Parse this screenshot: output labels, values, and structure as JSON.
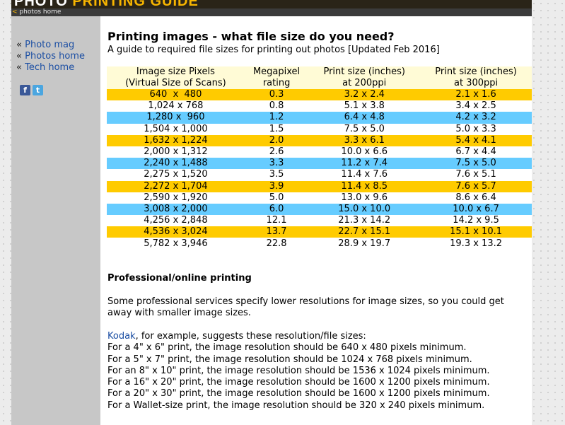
{
  "header": {
    "logo_word1": "PHOTO",
    "logo_word2": "PRINTING GUIDE",
    "breadcrumb_arrow": "<",
    "breadcrumb": "photos home"
  },
  "sidebar": {
    "items": [
      {
        "prefix": "«",
        "label": "Photo mag"
      },
      {
        "prefix": "«",
        "label": "Photos home"
      },
      {
        "prefix": "«",
        "label": "Tech home"
      }
    ],
    "social": {
      "facebook": "f",
      "twitter": "t"
    }
  },
  "main": {
    "title": "Printing images - what file size do you need?",
    "subtitle": "A guide to required file sizes for printing out photos [Updated Feb 2016]",
    "table": {
      "headers": [
        {
          "line1": "Image size Pixels",
          "line2": "(Virtual Size of Scans)"
        },
        {
          "line1": "Megapixel",
          "line2": "rating"
        },
        {
          "line1": "Print size (inches)",
          "line2": "at 200ppi"
        },
        {
          "line1": "Print size (inches)",
          "line2": "at 300ppi"
        }
      ],
      "rows": [
        {
          "color": "orange",
          "cells": [
            "640  x  480",
            "0.3",
            "3.2 x 2.4",
            "2.1 x 1.6"
          ]
        },
        {
          "color": "white",
          "cells": [
            "1,024 x 768",
            "0.8",
            "5.1 x 3.8",
            "3.4 x 2.5"
          ]
        },
        {
          "color": "blue",
          "cells": [
            "1,280 x  960",
            "1.2",
            "6.4 x 4.8",
            "4.2 x 3.2"
          ]
        },
        {
          "color": "white",
          "cells": [
            "1,504 x 1,000",
            "1.5",
            "7.5 x 5.0",
            "5.0 x 3.3"
          ]
        },
        {
          "color": "orange",
          "cells": [
            "1,632 x 1,224",
            "2.0",
            "3.3 x 6.1",
            "5.4 x 4.1"
          ]
        },
        {
          "color": "white",
          "cells": [
            "2,000 x 1,312",
            "2.6",
            "10.0 x 6.6",
            "6.7 x 4.4"
          ]
        },
        {
          "color": "blue",
          "cells": [
            "2,240 x 1,488",
            "3.3",
            "11.2 x 7.4",
            "7.5 x 5.0"
          ]
        },
        {
          "color": "white",
          "cells": [
            "2,275 x 1,520",
            "3.5",
            "11.4 x 7.6",
            "7.6 x 5.1"
          ]
        },
        {
          "color": "orange",
          "cells": [
            "2,272 x 1,704",
            "3.9",
            "11.4 x 8.5",
            "7.6 x 5.7"
          ]
        },
        {
          "color": "white",
          "cells": [
            "2,590 x 1,920",
            "5.0",
            "13.0 x 9.6",
            "8.6 x 6.4"
          ]
        },
        {
          "color": "blue",
          "cells": [
            "3,008 x 2,000",
            "6.0",
            "15.0 x 10.0",
            "10.0 x 6.7"
          ]
        },
        {
          "color": "white",
          "cells": [
            "4,256 x 2,848",
            "12.1",
            "21.3 x 14.2",
            "14.2 x 9.5"
          ]
        },
        {
          "color": "orange",
          "cells": [
            "4,536 x 3,024",
            "13.7",
            "22.7 x 15.1",
            "15.1 x 10.1"
          ]
        },
        {
          "color": "white",
          "cells": [
            "5,782 x 3,946",
            "22.8",
            "28.9 x 19.7",
            "19.3 x 13.2"
          ]
        }
      ]
    },
    "pro_heading": "Professional/online printing",
    "pro_text": "Some professional services specify lower resolutions for image sizes, so you could get away with smaller image sizes.",
    "kodak_link": "Kodak",
    "kodak_intro_rest": ", for example, suggests these resolution/file sizes:",
    "kodak_lines": [
      "For a 4\" x 6\" print, the image resolution should be 640 x 480 pixels minimum.",
      "For a 5\" x 7\" print, the image resolution should be 1024 x 768 pixels minimum.",
      "For an 8\" x 10\" print, the image resolution should be 1536 x 1024 pixels minimum.",
      "For a 16\" x 20\" print, the image resolution should be 1600 x 1200 pixels minimum.",
      "For a 20\" x 30\" print, the image resolution should be 1600 x 1200 pixels minimum.",
      "For a Wallet-size print, the image resolution should be 320 x 240 pixels minimum."
    ]
  },
  "colors": {
    "orange_row": "#ffcb00",
    "blue_row": "#66ccff",
    "header_row": "#fffbd6",
    "link": "#1b4ea3",
    "sidebar_bg": "#c7c7c7"
  }
}
